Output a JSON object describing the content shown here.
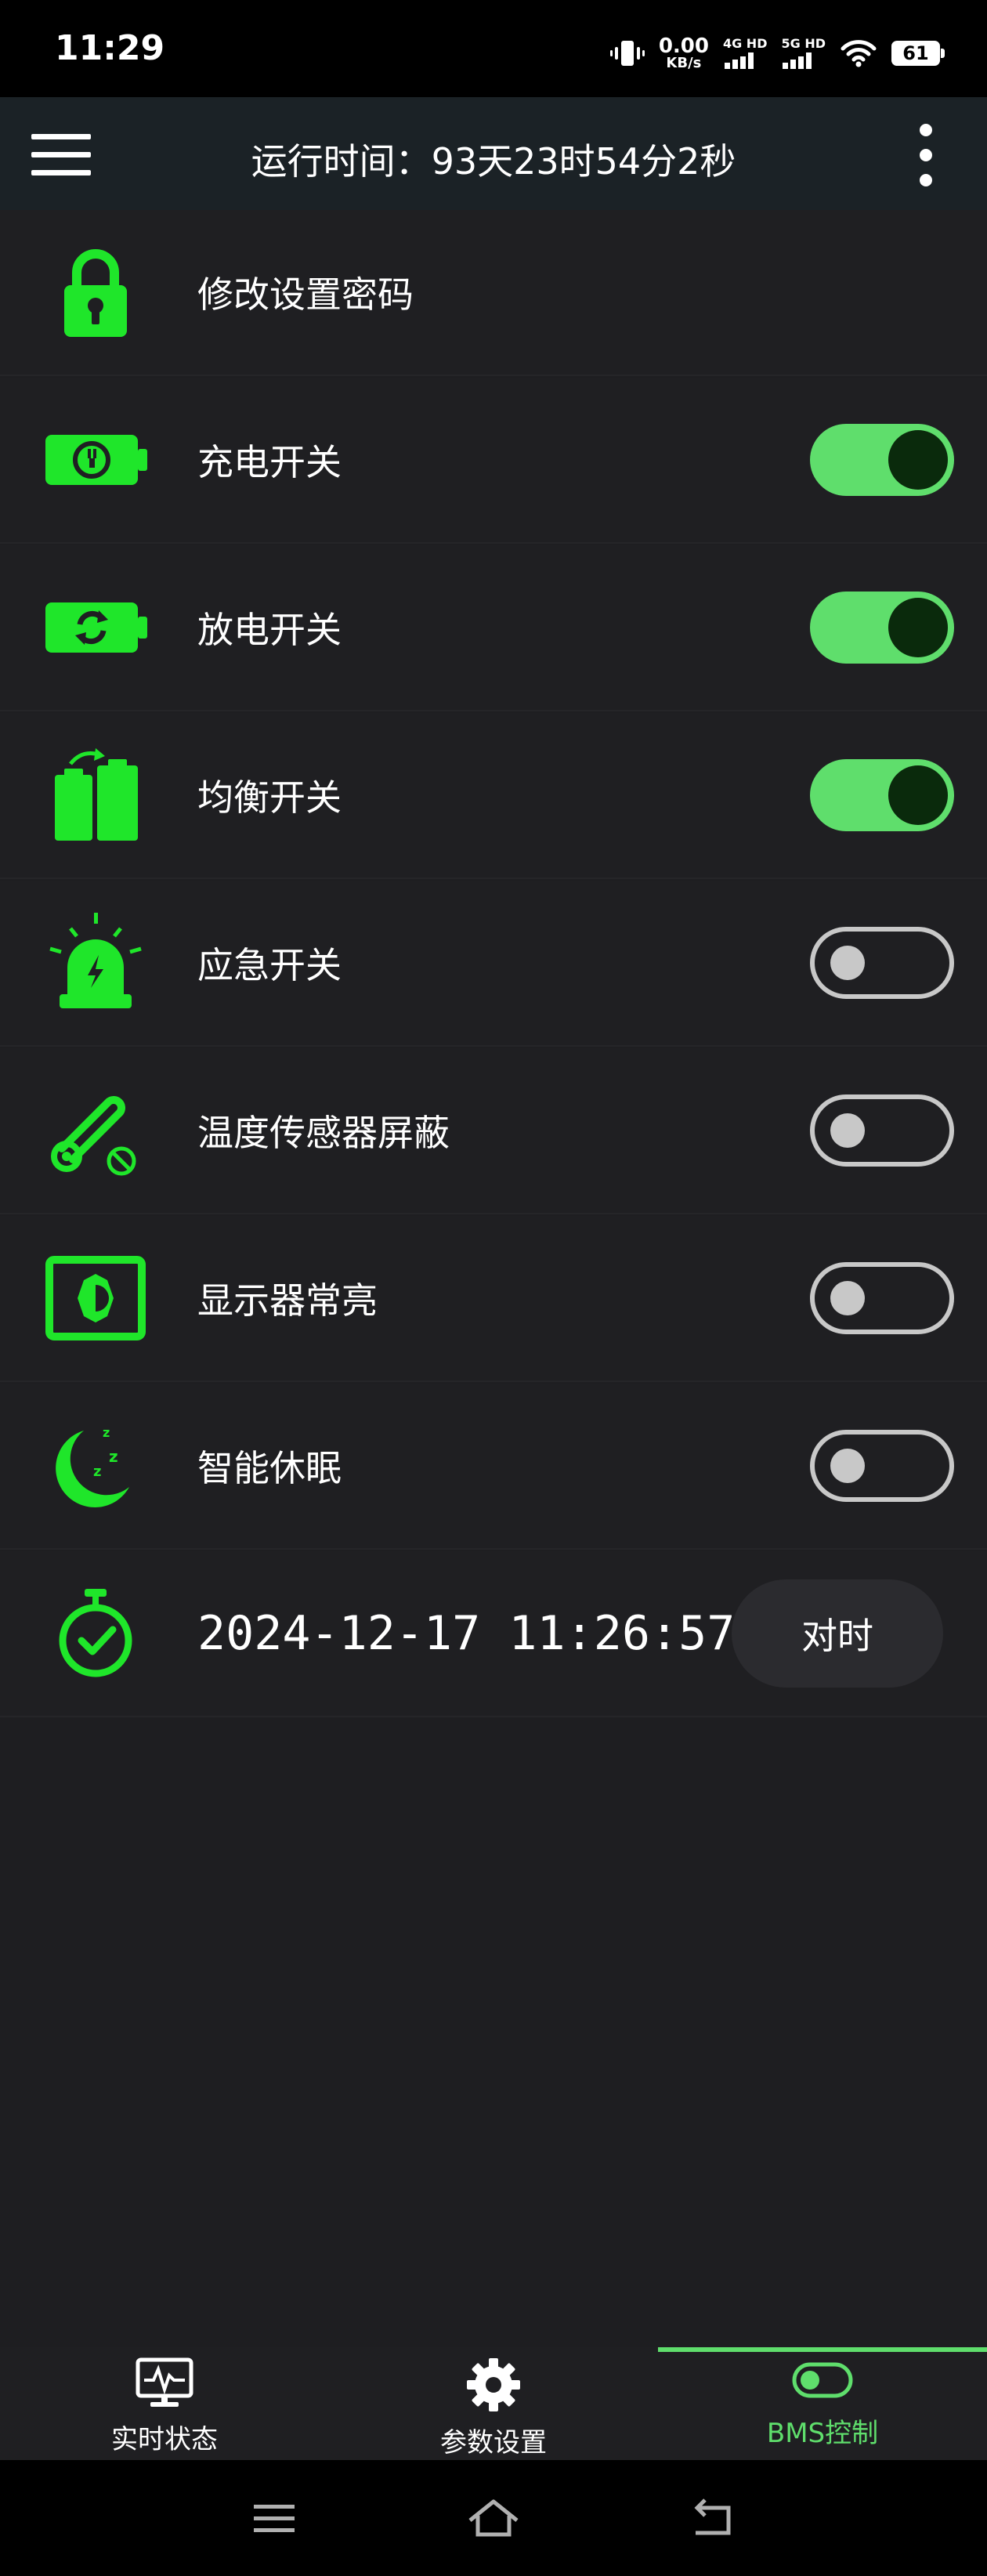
{
  "status_bar": {
    "time": "11:29",
    "net_speed_value": "0.00",
    "net_speed_unit": "KB/s",
    "sim1_label": "4G HD",
    "sim2_label": "5G HD",
    "battery_level": "61"
  },
  "app_bar": {
    "title": "运行时间：93天23时54分2秒"
  },
  "settings": {
    "change_password": {
      "label": "修改设置密码"
    },
    "charge": {
      "label": "充电开关",
      "on": true
    },
    "discharge": {
      "label": "放电开关",
      "on": true
    },
    "balance": {
      "label": "均衡开关",
      "on": true
    },
    "emergency": {
      "label": "应急开关",
      "on": false
    },
    "temp_sensor_mask": {
      "label": "温度传感器屏蔽",
      "on": false
    },
    "display_always_on": {
      "label": "显示器常亮",
      "on": false
    },
    "smart_sleep": {
      "label": "智能休眠",
      "on": false
    },
    "time_sync": {
      "datetime": "2024-12-17 11:26:57",
      "button_label": "对时"
    }
  },
  "bottom_nav": {
    "items": [
      {
        "label": "实时状态",
        "icon": "monitor-icon"
      },
      {
        "label": "参数设置",
        "icon": "gear-icon"
      },
      {
        "label": "BMS控制",
        "icon": "toggle-icon",
        "active": true
      }
    ]
  },
  "colors": {
    "accent_green": "#1fe62a",
    "toggle_green": "#5fde6c",
    "background": "#1e1e21",
    "app_bar": "#1b2226"
  }
}
